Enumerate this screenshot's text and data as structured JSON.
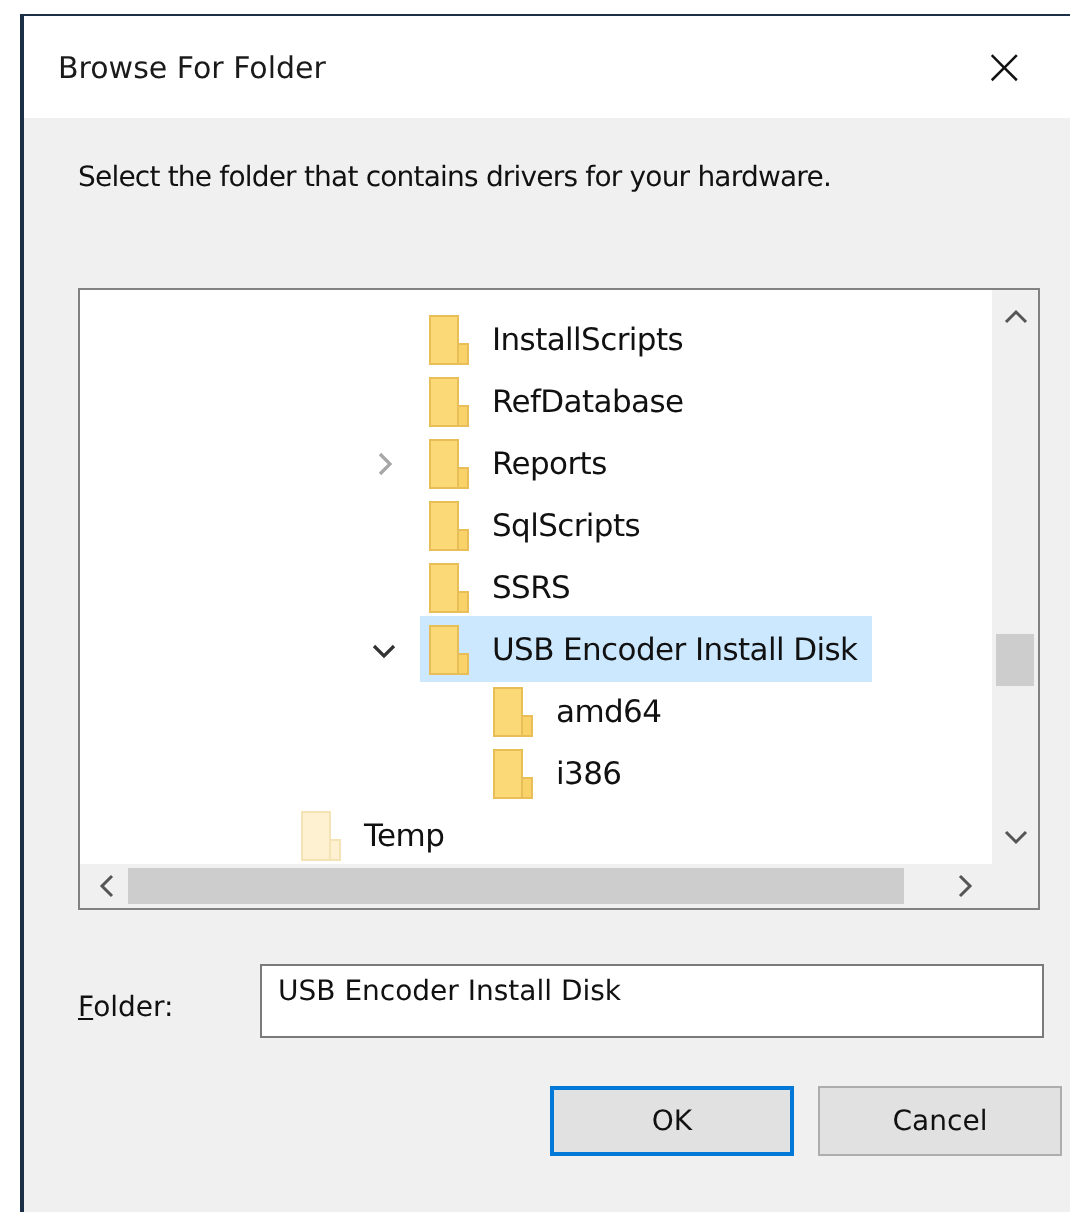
{
  "window": {
    "title": "Browse For Folder",
    "close": "×"
  },
  "instruction": "Select the folder that contains drivers for your hardware.",
  "tree": {
    "items": [
      {
        "label": "InstallScripts",
        "selected": false
      },
      {
        "label": "RefDatabase",
        "selected": false
      },
      {
        "label": "Reports",
        "expanded": false,
        "selected": false
      },
      {
        "label": "SqlScripts",
        "selected": false
      },
      {
        "label": "SSRS",
        "selected": false
      },
      {
        "label": "USB Encoder Install Disk",
        "expanded": true,
        "selected": true,
        "children": [
          {
            "label": "amd64",
            "selected": false
          },
          {
            "label": "i386",
            "selected": false
          }
        ]
      }
    ],
    "outer_items": [
      {
        "label": "Temp",
        "selected": false
      }
    ]
  },
  "folder": {
    "label": "Folder:",
    "value": "USB Encoder Install Disk"
  },
  "buttons": [
    {
      "label": "OK",
      "default": true
    },
    {
      "label": "Cancel",
      "default": false
    }
  ]
}
